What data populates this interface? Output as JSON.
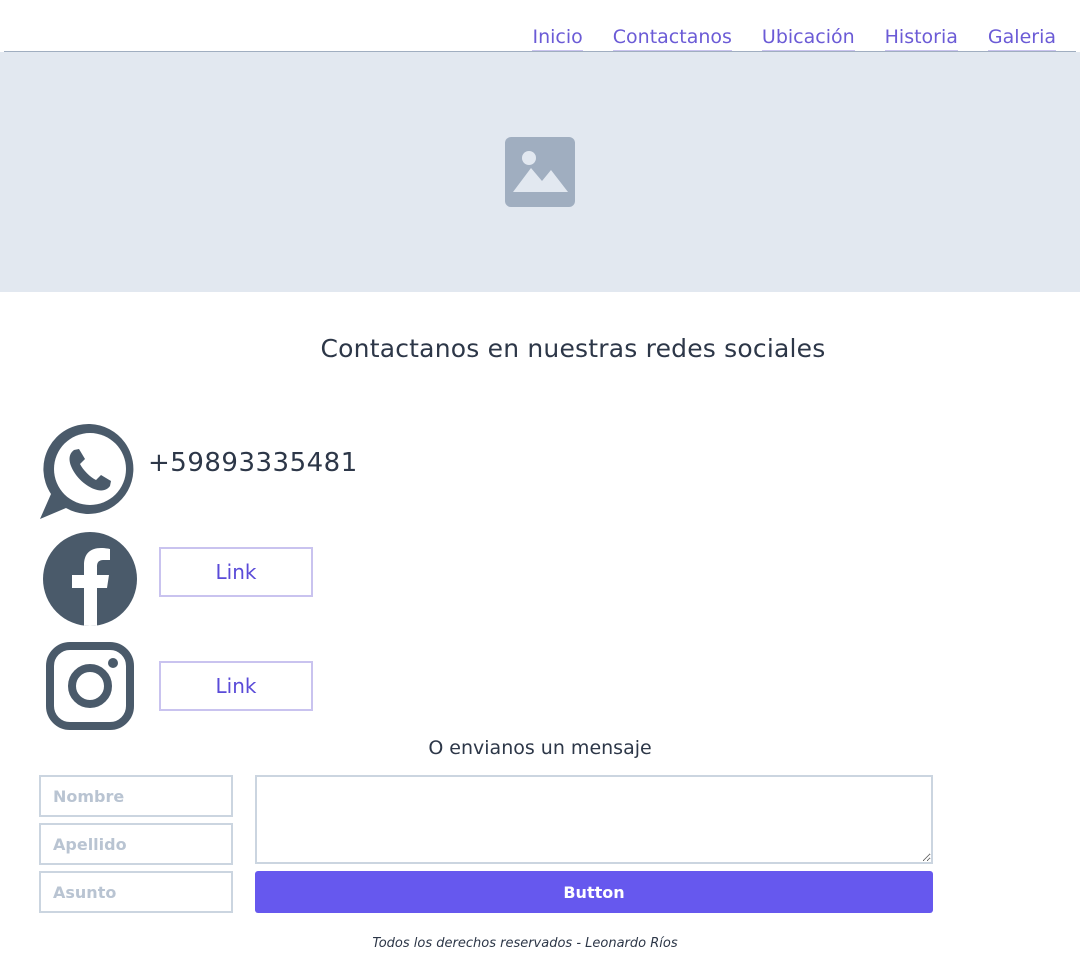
{
  "nav": {
    "items": [
      {
        "label": "Inicio"
      },
      {
        "label": "Contactanos"
      },
      {
        "label": "Ubicación"
      },
      {
        "label": "Historia"
      },
      {
        "label": "Galeria"
      }
    ]
  },
  "hero": {
    "icon": "image-placeholder-icon"
  },
  "social": {
    "title": "Contactanos en nuestras redes sociales",
    "whatsapp": {
      "icon": "whatsapp-icon",
      "phone": "+59893335481"
    },
    "facebook": {
      "icon": "facebook-icon",
      "link_label": "Link"
    },
    "instagram": {
      "icon": "instagram-icon",
      "link_label": "Link"
    }
  },
  "message": {
    "title": "O envianos un mensaje",
    "fields": {
      "nombre_placeholder": "Nombre",
      "apellido_placeholder": "Apellido",
      "asunto_placeholder": "Asunto",
      "message_value": ""
    },
    "submit_label": "Button"
  },
  "footer": {
    "text": "Todos los derechos reservados - Leonardo Ríos"
  },
  "colors": {
    "accent": "#6658ee",
    "link": "#6b5bd6",
    "hero_bg": "#e2e8f0",
    "icon_gray": "#4a5a6a"
  }
}
